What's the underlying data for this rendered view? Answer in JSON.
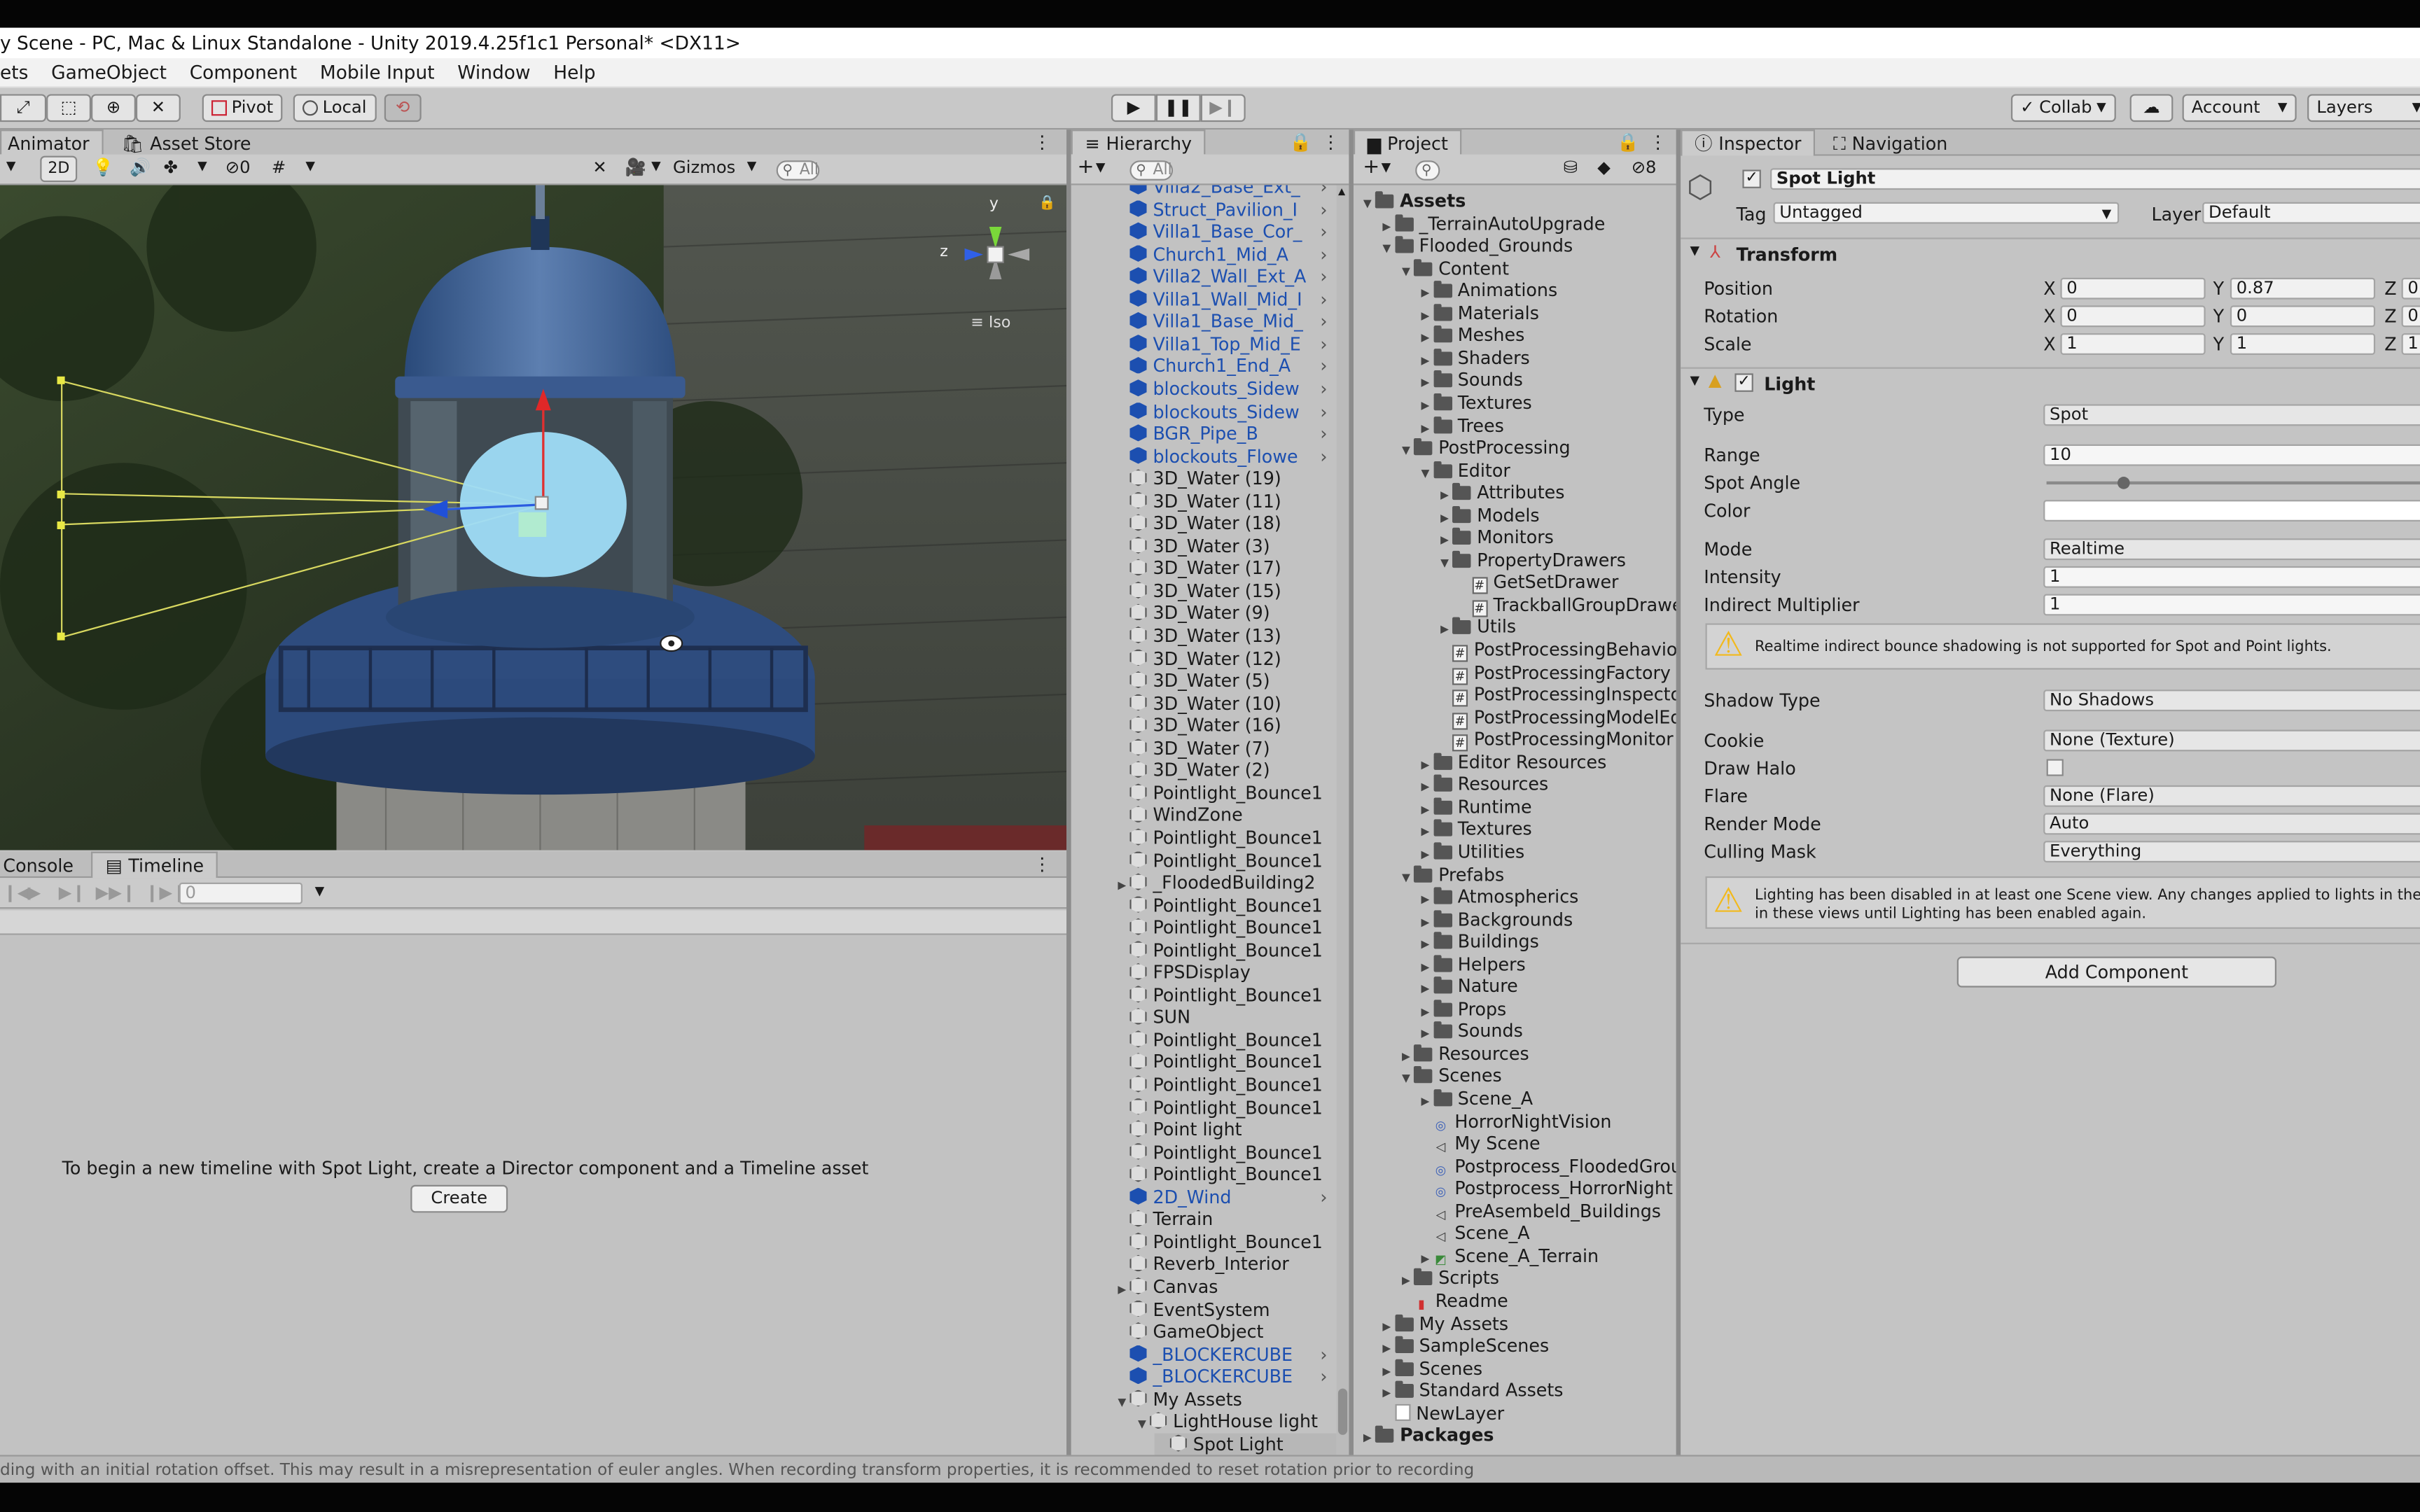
{
  "window": {
    "title": "y Scene - PC, Mac & Linux Standalone - Unity 2019.4.25f1c1 Personal* <DX11>"
  },
  "menu": [
    "ets",
    "GameObject",
    "Component",
    "Mobile Input",
    "Window",
    "Help"
  ],
  "toolbar": {
    "pivot": "Pivot",
    "local": "Local",
    "collab": "Collab",
    "account": "Account",
    "layers": "Layers"
  },
  "scene_panel": {
    "tabs": [
      "Animator",
      "Asset Store"
    ],
    "mode_2d": "2D",
    "hidden_count": "0",
    "gizmos": "Gizmos",
    "search_placeholder": "All",
    "iso_label": "Iso",
    "axis_y": "y",
    "axis_z": "z"
  },
  "timeline_panel": {
    "tabs": [
      "Console",
      "Timeline"
    ],
    "frame": "0",
    "message": "To begin a new timeline with Spot Light, create a Director component and a Timeline asset",
    "create_button": "Create"
  },
  "hierarchy": {
    "tab": "Hierarchy",
    "search_placeholder": "All",
    "rows": [
      {
        "label": "Villa2_Base_Ext_",
        "kind": "prefab",
        "indent": 0,
        "expand": "",
        "more": true
      },
      {
        "label": "Struct_Pavilion_I",
        "kind": "prefab",
        "indent": 0,
        "expand": "",
        "more": true
      },
      {
        "label": "Villa1_Base_Cor_",
        "kind": "prefab",
        "indent": 0,
        "expand": "",
        "more": true
      },
      {
        "label": "Church1_Mid_A",
        "kind": "prefab",
        "indent": 0,
        "expand": "",
        "more": true
      },
      {
        "label": "Villa2_Wall_Ext_A",
        "kind": "prefab",
        "indent": 0,
        "expand": "",
        "more": true
      },
      {
        "label": "Villa1_Wall_Mid_I",
        "kind": "prefab",
        "indent": 0,
        "expand": "",
        "more": true
      },
      {
        "label": "Villa1_Base_Mid_",
        "kind": "prefab",
        "indent": 0,
        "expand": "",
        "more": true
      },
      {
        "label": "Villa1_Top_Mid_E",
        "kind": "prefab",
        "indent": 0,
        "expand": "",
        "more": true
      },
      {
        "label": "Church1_End_A",
        "kind": "prefab",
        "indent": 0,
        "expand": "",
        "more": true
      },
      {
        "label": "blockouts_Sidew",
        "kind": "prefab",
        "indent": 0,
        "expand": "",
        "more": true
      },
      {
        "label": "blockouts_Sidew",
        "kind": "prefab",
        "indent": 0,
        "expand": "",
        "more": true
      },
      {
        "label": "BGR_Pipe_B",
        "kind": "prefab",
        "indent": 0,
        "expand": "",
        "more": true
      },
      {
        "label": "blockouts_Flowe",
        "kind": "prefab",
        "indent": 0,
        "expand": "",
        "more": true
      },
      {
        "label": "3D_Water (19)",
        "kind": "object",
        "indent": 0,
        "expand": "",
        "more": false
      },
      {
        "label": "3D_Water (11)",
        "kind": "object",
        "indent": 0,
        "expand": "",
        "more": false
      },
      {
        "label": "3D_Water (18)",
        "kind": "object",
        "indent": 0,
        "expand": "",
        "more": false
      },
      {
        "label": "3D_Water (3)",
        "kind": "object",
        "indent": 0,
        "expand": "",
        "more": false
      },
      {
        "label": "3D_Water (17)",
        "kind": "object",
        "indent": 0,
        "expand": "",
        "more": false
      },
      {
        "label": "3D_Water (15)",
        "kind": "object",
        "indent": 0,
        "expand": "",
        "more": false
      },
      {
        "label": "3D_Water (9)",
        "kind": "object",
        "indent": 0,
        "expand": "",
        "more": false
      },
      {
        "label": "3D_Water (13)",
        "kind": "object",
        "indent": 0,
        "expand": "",
        "more": false
      },
      {
        "label": "3D_Water (12)",
        "kind": "object",
        "indent": 0,
        "expand": "",
        "more": false
      },
      {
        "label": "3D_Water (5)",
        "kind": "object",
        "indent": 0,
        "expand": "",
        "more": false
      },
      {
        "label": "3D_Water (10)",
        "kind": "object",
        "indent": 0,
        "expand": "",
        "more": false
      },
      {
        "label": "3D_Water (16)",
        "kind": "object",
        "indent": 0,
        "expand": "",
        "more": false
      },
      {
        "label": "3D_Water (7)",
        "kind": "object",
        "indent": 0,
        "expand": "",
        "more": false
      },
      {
        "label": "3D_Water (2)",
        "kind": "object",
        "indent": 0,
        "expand": "",
        "more": false
      },
      {
        "label": "Pointlight_Bounce1",
        "kind": "object",
        "indent": 0,
        "expand": "",
        "more": false
      },
      {
        "label": "WindZone",
        "kind": "object",
        "indent": 0,
        "expand": "",
        "more": false
      },
      {
        "label": "Pointlight_Bounce1",
        "kind": "object",
        "indent": 0,
        "expand": "",
        "more": false
      },
      {
        "label": "Pointlight_Bounce1",
        "kind": "object",
        "indent": 0,
        "expand": "",
        "more": false
      },
      {
        "label": "_FloodedBuilding2",
        "kind": "object",
        "indent": 0,
        "expand": "closed",
        "more": false
      },
      {
        "label": "Pointlight_Bounce1",
        "kind": "object",
        "indent": 0,
        "expand": "",
        "more": false
      },
      {
        "label": "Pointlight_Bounce1",
        "kind": "object",
        "indent": 0,
        "expand": "",
        "more": false
      },
      {
        "label": "Pointlight_Bounce1",
        "kind": "object",
        "indent": 0,
        "expand": "",
        "more": false
      },
      {
        "label": "FPSDisplay",
        "kind": "object",
        "indent": 0,
        "expand": "",
        "more": false
      },
      {
        "label": "Pointlight_Bounce1",
        "kind": "object",
        "indent": 0,
        "expand": "",
        "more": false
      },
      {
        "label": "SUN",
        "kind": "object",
        "indent": 0,
        "expand": "",
        "more": false
      },
      {
        "label": "Pointlight_Bounce1",
        "kind": "object",
        "indent": 0,
        "expand": "",
        "more": false
      },
      {
        "label": "Pointlight_Bounce1",
        "kind": "object",
        "indent": 0,
        "expand": "",
        "more": false
      },
      {
        "label": "Pointlight_Bounce1",
        "kind": "object",
        "indent": 0,
        "expand": "",
        "more": false
      },
      {
        "label": "Pointlight_Bounce1",
        "kind": "object",
        "indent": 0,
        "expand": "",
        "more": false
      },
      {
        "label": "Point light",
        "kind": "object",
        "indent": 0,
        "expand": "",
        "more": false
      },
      {
        "label": "Pointlight_Bounce1",
        "kind": "object",
        "indent": 0,
        "expand": "",
        "more": false
      },
      {
        "label": "Pointlight_Bounce1",
        "kind": "object",
        "indent": 0,
        "expand": "",
        "more": false
      },
      {
        "label": "2D_Wind",
        "kind": "prefab",
        "indent": 0,
        "expand": "",
        "more": true
      },
      {
        "label": "Terrain",
        "kind": "object",
        "indent": 0,
        "expand": "",
        "more": false
      },
      {
        "label": "Pointlight_Bounce1",
        "kind": "object",
        "indent": 0,
        "expand": "",
        "more": false
      },
      {
        "label": "Reverb_Interior",
        "kind": "object",
        "indent": 0,
        "expand": "",
        "more": false
      },
      {
        "label": "Canvas",
        "kind": "object",
        "indent": 0,
        "expand": "closed",
        "more": false
      },
      {
        "label": "EventSystem",
        "kind": "object",
        "indent": 0,
        "expand": "",
        "more": false
      },
      {
        "label": "GameObject",
        "kind": "object",
        "indent": 0,
        "expand": "",
        "more": false
      },
      {
        "label": "_BLOCKERCUBE",
        "kind": "prefab",
        "indent": 0,
        "expand": "",
        "more": true
      },
      {
        "label": "_BLOCKERCUBE",
        "kind": "prefab",
        "indent": 0,
        "expand": "",
        "more": true
      },
      {
        "label": "My Assets",
        "kind": "object",
        "indent": 0,
        "expand": "open",
        "more": false
      },
      {
        "label": "LightHouse light",
        "kind": "object",
        "indent": 1,
        "expand": "open",
        "more": false
      },
      {
        "label": "Spot Light",
        "kind": "object",
        "indent": 2,
        "expand": "",
        "more": false
      }
    ]
  },
  "project": {
    "tab": "Project",
    "badge": "8",
    "rows": [
      {
        "label": "Assets",
        "kind": "folder",
        "indent": 0,
        "expand": "open",
        "bold": true
      },
      {
        "label": "_TerrainAutoUpgrade",
        "kind": "folder",
        "indent": 1,
        "expand": "closed"
      },
      {
        "label": "Flooded_Grounds",
        "kind": "folder",
        "indent": 1,
        "expand": "open"
      },
      {
        "label": "Content",
        "kind": "folder",
        "indent": 2,
        "expand": "open"
      },
      {
        "label": "Animations",
        "kind": "folder",
        "indent": 3,
        "expand": "closed"
      },
      {
        "label": "Materials",
        "kind": "folder",
        "indent": 3,
        "expand": "closed"
      },
      {
        "label": "Meshes",
        "kind": "folder",
        "indent": 3,
        "expand": "closed"
      },
      {
        "label": "Shaders",
        "kind": "folder",
        "indent": 3,
        "expand": "closed"
      },
      {
        "label": "Sounds",
        "kind": "folder",
        "indent": 3,
        "expand": "closed"
      },
      {
        "label": "Textures",
        "kind": "folder",
        "indent": 3,
        "expand": "closed"
      },
      {
        "label": "Trees",
        "kind": "folder",
        "indent": 3,
        "expand": "closed"
      },
      {
        "label": "PostProcessing",
        "kind": "folder",
        "indent": 2,
        "expand": "open"
      },
      {
        "label": "Editor",
        "kind": "folder",
        "indent": 3,
        "expand": "open"
      },
      {
        "label": "Attributes",
        "kind": "folder",
        "indent": 4,
        "expand": "closed"
      },
      {
        "label": "Models",
        "kind": "folder",
        "indent": 4,
        "expand": "closed"
      },
      {
        "label": "Monitors",
        "kind": "folder",
        "indent": 4,
        "expand": "closed"
      },
      {
        "label": "PropertyDrawers",
        "kind": "folder",
        "indent": 4,
        "expand": "open"
      },
      {
        "label": "GetSetDrawer",
        "kind": "script",
        "indent": 5,
        "expand": ""
      },
      {
        "label": "TrackballGroupDrawe",
        "kind": "script",
        "indent": 5,
        "expand": ""
      },
      {
        "label": "Utils",
        "kind": "folder",
        "indent": 4,
        "expand": "closed"
      },
      {
        "label": "PostProcessingBehaviou",
        "kind": "script",
        "indent": 4,
        "expand": ""
      },
      {
        "label": "PostProcessingFactory",
        "kind": "script",
        "indent": 4,
        "expand": ""
      },
      {
        "label": "PostProcessingInspector",
        "kind": "script",
        "indent": 4,
        "expand": ""
      },
      {
        "label": "PostProcessingModelEdi",
        "kind": "script",
        "indent": 4,
        "expand": ""
      },
      {
        "label": "PostProcessingMonitor",
        "kind": "script",
        "indent": 4,
        "expand": ""
      },
      {
        "label": "Editor Resources",
        "kind": "folder",
        "indent": 3,
        "expand": "closed"
      },
      {
        "label": "Resources",
        "kind": "folder",
        "indent": 3,
        "expand": "closed"
      },
      {
        "label": "Runtime",
        "kind": "folder",
        "indent": 3,
        "expand": "closed"
      },
      {
        "label": "Textures",
        "kind": "folder",
        "indent": 3,
        "expand": "closed"
      },
      {
        "label": "Utilities",
        "kind": "folder",
        "indent": 3,
        "expand": "closed"
      },
      {
        "label": "Prefabs",
        "kind": "folder",
        "indent": 2,
        "expand": "open"
      },
      {
        "label": "Atmospherics",
        "kind": "folder",
        "indent": 3,
        "expand": "closed"
      },
      {
        "label": "Backgrounds",
        "kind": "folder",
        "indent": 3,
        "expand": "closed"
      },
      {
        "label": "Buildings",
        "kind": "folder",
        "indent": 3,
        "expand": "closed"
      },
      {
        "label": "Helpers",
        "kind": "folder",
        "indent": 3,
        "expand": "closed"
      },
      {
        "label": "Nature",
        "kind": "folder",
        "indent": 3,
        "expand": "closed"
      },
      {
        "label": "Props",
        "kind": "folder",
        "indent": 3,
        "expand": "closed"
      },
      {
        "label": "Sounds",
        "kind": "folder",
        "indent": 3,
        "expand": "closed"
      },
      {
        "label": "Resources",
        "kind": "folder",
        "indent": 2,
        "expand": "closed"
      },
      {
        "label": "Scenes",
        "kind": "folder",
        "indent": 2,
        "expand": "open"
      },
      {
        "label": "Scene_A",
        "kind": "folder",
        "indent": 3,
        "expand": "closed"
      },
      {
        "label": "HorrorNightVision",
        "kind": "postprocess",
        "indent": 3,
        "expand": ""
      },
      {
        "label": "My Scene",
        "kind": "scene",
        "indent": 3,
        "expand": ""
      },
      {
        "label": "Postprocess_FloodedGroun",
        "kind": "postprocess",
        "indent": 3,
        "expand": ""
      },
      {
        "label": "Postprocess_HorrorNight",
        "kind": "postprocess",
        "indent": 3,
        "expand": ""
      },
      {
        "label": "PreAsembeld_Buildings",
        "kind": "scene",
        "indent": 3,
        "expand": ""
      },
      {
        "label": "Scene_A",
        "kind": "scene",
        "indent": 3,
        "expand": ""
      },
      {
        "label": "Scene_A_Terrain",
        "kind": "terrain",
        "indent": 3,
        "expand": "closed"
      },
      {
        "label": "Scripts",
        "kind": "folder",
        "indent": 2,
        "expand": "closed"
      },
      {
        "label": "Readme",
        "kind": "readme",
        "indent": 2,
        "expand": ""
      },
      {
        "label": "My Assets",
        "kind": "folder",
        "indent": 1,
        "expand": "closed"
      },
      {
        "label": "SampleScenes",
        "kind": "folder",
        "indent": 1,
        "expand": "closed"
      },
      {
        "label": "Scenes",
        "kind": "folder",
        "indent": 1,
        "expand": "closed"
      },
      {
        "label": "Standard Assets",
        "kind": "folder",
        "indent": 1,
        "expand": "closed"
      },
      {
        "label": "NewLayer",
        "kind": "file",
        "indent": 1,
        "expand": ""
      },
      {
        "label": "Packages",
        "kind": "folder",
        "indent": 0,
        "expand": "closed",
        "bold": true
      }
    ]
  },
  "inspector": {
    "tabs": [
      "Inspector",
      "Navigation"
    ],
    "object_name": "Spot Light",
    "tag_label": "Tag",
    "tag_value": "Untagged",
    "layer_label": "Layer",
    "layer_value": "Default",
    "transform": {
      "title": "Transform",
      "position_label": "Position",
      "rotation_label": "Rotation",
      "scale_label": "Scale",
      "x": "X",
      "y": "Y",
      "z": "Z",
      "position": [
        "0",
        "0.87",
        "0"
      ],
      "rotation": [
        "0",
        "0",
        "0"
      ],
      "scale": [
        "1",
        "1",
        "1"
      ]
    },
    "light": {
      "title": "Light",
      "props": [
        {
          "label": "Type",
          "value": "Spot"
        },
        {
          "label": "Range",
          "value": "10"
        },
        {
          "label": "Spot Angle",
          "value": ""
        },
        {
          "label": "Color",
          "value": ""
        },
        {
          "label": "Mode",
          "value": "Realtime"
        },
        {
          "label": "Intensity",
          "value": "1"
        },
        {
          "label": "Indirect Multiplier",
          "value": "1"
        }
      ],
      "warning1": "Realtime indirect bounce shadowing is not supported for Spot and Point lights.",
      "props2": [
        {
          "label": "Shadow Type",
          "value": "No Shadows"
        },
        {
          "label": "Cookie",
          "value": "None (Texture)"
        },
        {
          "label": "Draw Halo",
          "value": ""
        },
        {
          "label": "Flare",
          "value": "None (Flare)"
        },
        {
          "label": "Render Mode",
          "value": "Auto"
        },
        {
          "label": "Culling Mask",
          "value": "Everything"
        }
      ],
      "warning2_line1": "Lighting has been disabled in at least one Scene view. Any changes applied to lights in the Scene w",
      "warning2_line2": "in these views until Lighting has been enabled again.",
      "spot_angle_fraction": 0.2
    },
    "add_component": "Add Component"
  },
  "statusbar": {
    "text": "ding with an initial rotation offset. This may result in a misrepresentation of euler angles. When recording transform properties, it is recommended to reset rotation prior to recording"
  },
  "colors": {
    "prefab_blue": "#1c4fb0",
    "warning_yellow": "#f2b91c"
  }
}
